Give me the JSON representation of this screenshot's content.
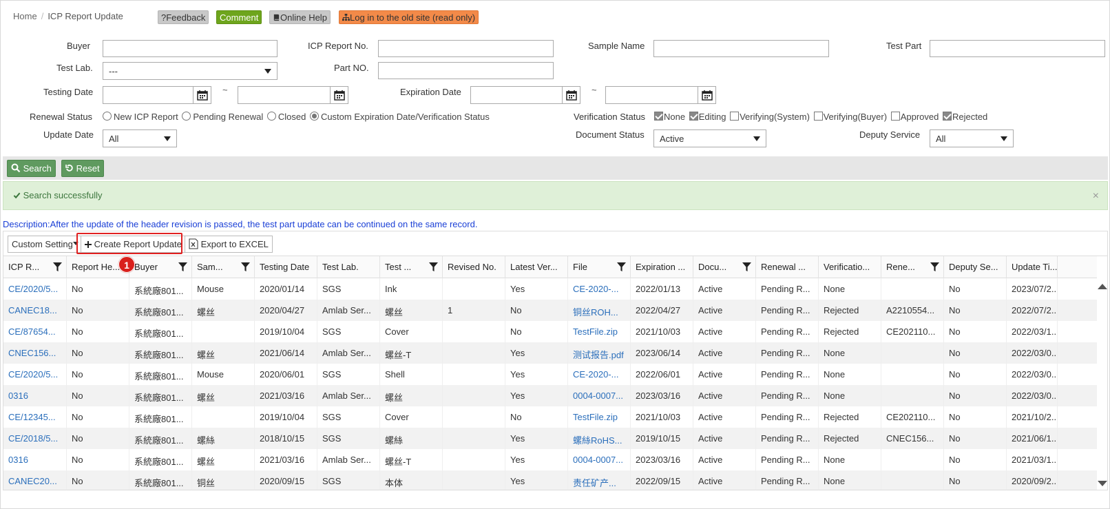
{
  "breadcrumb": {
    "home": "Home",
    "sep": "/",
    "current": "ICP Report Update"
  },
  "topbar": {
    "feedback": "?Feedback",
    "comment": "Comment",
    "online_help": "Online Help",
    "old_site": "Log in to the old site (read only)"
  },
  "filters": {
    "buyer": {
      "label": "Buyer",
      "value": ""
    },
    "icp_report_no": {
      "label": "ICP Report No.",
      "value": ""
    },
    "sample_name": {
      "label": "Sample Name",
      "value": ""
    },
    "test_part": {
      "label": "Test Part",
      "value": ""
    },
    "test_lab": {
      "label": "Test Lab.",
      "value": "---"
    },
    "part_no": {
      "label": "Part NO.",
      "value": ""
    },
    "testing_date": {
      "label": "Testing Date",
      "sep": "~"
    },
    "expiration_date": {
      "label": "Expiration Date",
      "sep": "~"
    },
    "renewal_status": {
      "label": "Renewal Status",
      "options": [
        "New ICP Report",
        "Pending Renewal",
        "Closed",
        "Custom Expiration Date/Verification Status"
      ],
      "selected": 3
    },
    "verification_status": {
      "label": "Verification Status",
      "options": [
        {
          "label": "None",
          "checked": true
        },
        {
          "label": "Editing",
          "checked": true
        },
        {
          "label": "Verifying(System)",
          "checked": false
        },
        {
          "label": "Verifying(Buyer)",
          "checked": false
        },
        {
          "label": "Approved",
          "checked": false
        },
        {
          "label": "Rejected",
          "checked": true
        }
      ]
    },
    "update_date": {
      "label": "Update Date",
      "value": "All"
    },
    "document_status": {
      "label": "Document Status",
      "value": "Active"
    },
    "deputy_service": {
      "label": "Deputy Service",
      "value": "All"
    }
  },
  "actions": {
    "search": "Search",
    "reset": "Reset"
  },
  "alert": {
    "message": "Search successfully",
    "close": "×"
  },
  "description": "Description:After the update of the header revision is passed, the test part update can be continued on the same record.",
  "toolbar": {
    "custom_setting": "Custom Setting",
    "create_report_update": "Create Report Update",
    "export_excel": "Export to EXCEL",
    "step_badge": "1"
  },
  "table": {
    "columns": [
      {
        "label": "ICP R...",
        "filter": true
      },
      {
        "label": "Report He...",
        "filter": false
      },
      {
        "label": "Buyer",
        "filter": true
      },
      {
        "label": "Sam...",
        "filter": true
      },
      {
        "label": "Testing Date",
        "filter": false
      },
      {
        "label": "Test Lab.",
        "filter": false
      },
      {
        "label": "Test ...",
        "filter": true
      },
      {
        "label": "Revised No.",
        "filter": false
      },
      {
        "label": "Latest Ver...",
        "filter": false
      },
      {
        "label": "File",
        "filter": true
      },
      {
        "label": "Expiration ...",
        "filter": false
      },
      {
        "label": "Docu...",
        "filter": true
      },
      {
        "label": "Renewal ...",
        "filter": false
      },
      {
        "label": "Verificatio...",
        "filter": false
      },
      {
        "label": "Rene...",
        "filter": true
      },
      {
        "label": "Deputy Se...",
        "filter": false
      },
      {
        "label": "Update Ti...",
        "filter": false
      }
    ],
    "rows": [
      [
        "CE/2020/5...",
        "No",
        "系統廠801...",
        "Mouse",
        "2020/01/14",
        "SGS",
        "Ink",
        "",
        "Yes",
        "CE-2020-...",
        "2022/01/13",
        "Active",
        "Pending R...",
        "None",
        "",
        "No",
        "2023/07/2..."
      ],
      [
        "CANEC18...",
        "No",
        "系統廠801...",
        "螺丝",
        "2020/04/27",
        "Amlab Ser...",
        "螺丝",
        "1",
        "No",
        "铜丝ROH...",
        "2022/04/27",
        "Active",
        "Pending R...",
        "Rejected",
        "A2210554...",
        "No",
        "2022/07/2..."
      ],
      [
        "CE/87654...",
        "No",
        "系統廠801...",
        "",
        "2019/10/04",
        "SGS",
        "Cover",
        "",
        "No",
        "TestFile.zip",
        "2021/10/03",
        "Active",
        "Pending R...",
        "Rejected",
        "CE202110...",
        "No",
        "2022/03/1..."
      ],
      [
        "CNEC156...",
        "No",
        "系統廠801...",
        "螺丝",
        "2021/06/14",
        "Amlab Ser...",
        "螺丝-T",
        "",
        "Yes",
        "测试报告.pdf",
        "2023/06/14",
        "Active",
        "Pending R...",
        "None",
        "",
        "No",
        "2022/03/0..."
      ],
      [
        "CE/2020/5...",
        "No",
        "系統廠801...",
        "Mouse",
        "2020/06/01",
        "SGS",
        "Shell",
        "",
        "Yes",
        "CE-2020-...",
        "2022/06/01",
        "Active",
        "Pending R...",
        "None",
        "",
        "No",
        "2022/03/0..."
      ],
      [
        "0316",
        "No",
        "系統廠801...",
        "螺丝",
        "2021/03/16",
        "Amlab Ser...",
        "螺丝",
        "",
        "Yes",
        "0004-0007...",
        "2023/03/16",
        "Active",
        "Pending R...",
        "None",
        "",
        "No",
        "2022/03/0..."
      ],
      [
        "CE/12345...",
        "No",
        "系統廠801...",
        "",
        "2019/10/04",
        "SGS",
        "Cover",
        "",
        "No",
        "TestFile.zip",
        "2021/10/03",
        "Active",
        "Pending R...",
        "Rejected",
        "CE202110...",
        "No",
        "2021/10/2..."
      ],
      [
        "CE/2018/5...",
        "No",
        "系統廠801...",
        "螺絲",
        "2018/10/15",
        "SGS",
        "螺絲",
        "",
        "Yes",
        "螺絲RoHS...",
        "2019/10/15",
        "Active",
        "Pending R...",
        "Rejected",
        "CNEC156...",
        "No",
        "2021/06/1..."
      ],
      [
        "0316",
        "No",
        "系統廠801...",
        "螺丝",
        "2021/03/16",
        "Amlab Ser...",
        "螺丝-T",
        "",
        "Yes",
        "0004-0007...",
        "2023/03/16",
        "Active",
        "Pending R...",
        "None",
        "",
        "No",
        "2021/03/1..."
      ],
      [
        "CANEC20...",
        "No",
        "系統廠801...",
        "铜丝",
        "2020/09/15",
        "SGS",
        "本体",
        "",
        "Yes",
        "责任矿产...",
        "2022/09/15",
        "Active",
        "Pending R...",
        "None",
        "",
        "No",
        "2020/09/2..."
      ]
    ]
  }
}
